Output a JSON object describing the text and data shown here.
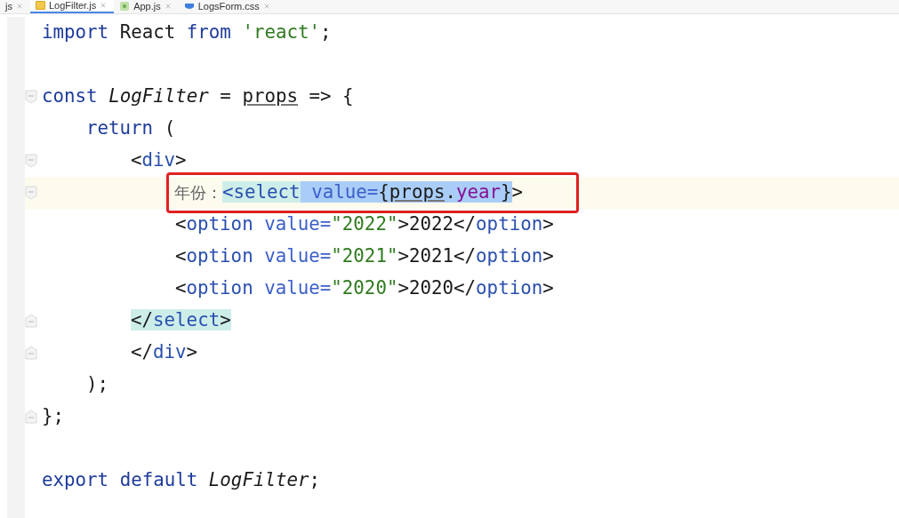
{
  "tabs": [
    {
      "label": "js",
      "kind": "plain",
      "selected": false
    },
    {
      "label": "LogFilter.js",
      "kind": "js",
      "selected": true
    },
    {
      "label": "App.js",
      "kind": "react",
      "selected": false
    },
    {
      "label": "LogsForm.css",
      "kind": "css",
      "selected": false
    }
  ],
  "lines": [
    {
      "kind": "code",
      "tokens": [
        {
          "text": "import",
          "kind": "keyword"
        },
        {
          "text": " React ",
          "kind": "plain"
        },
        {
          "text": "from",
          "kind": "keyword"
        },
        {
          "text": " 'react'",
          "kind": "string"
        },
        {
          "text": ";",
          "kind": "plain"
        }
      ]
    },
    {
      "kind": "blank"
    },
    {
      "kind": "fold-start",
      "tokens": [
        {
          "text": "const ",
          "kind": "keyword"
        },
        {
          "text": "LogFilter",
          "kind": "ident"
        },
        {
          "text": " = ",
          "kind": "plain"
        },
        {
          "text": "props",
          "kind": "param"
        },
        {
          "text": " => {",
          "kind": "plain"
        }
      ],
      "children": [
        {
          "kind": "code",
          "tokens": [
            {
              "text": "return",
              "kind": "keyword"
            },
            {
              "text": " (",
              "kind": "plain"
            }
          ],
          "children": [
            {
              "kind": "fold-start",
              "tokens": [
                {
                  "text": "<",
                  "kind": "plain"
                },
                {
                  "text": "div",
                  "kind": "tag"
                },
                {
                  "text": ">",
                  "kind": "plain"
                }
              ],
              "children": [
                {
                  "kind": "fold-start",
                  "current": true,
                  "boxed": true,
                  "tokens": [
                    {
                      "text": "年份：",
                      "kind": "cjk"
                    },
                    {
                      "text": "<select",
                      "kind": "tag",
                      "matched": true
                    },
                    {
                      "text": " value=",
                      "kind": "attr",
                      "selected": true
                    },
                    {
                      "text": "{",
                      "kind": "plain",
                      "selected": true
                    },
                    {
                      "text": "props",
                      "kind": "param",
                      "selected": true
                    },
                    {
                      "text": ".",
                      "kind": "plain",
                      "selected": true
                    },
                    {
                      "text": "year",
                      "kind": "field",
                      "selected": true
                    },
                    {
                      "text": "}",
                      "kind": "plain",
                      "selected": true
                    },
                    {
                      "text": ">",
                      "kind": "plain"
                    }
                  ]
                },
                {
                  "kind": "code",
                  "tokens": [
                    {
                      "text": "<",
                      "kind": "plain"
                    },
                    {
                      "text": "option",
                      "kind": "tag"
                    },
                    {
                      "text": " value=",
                      "kind": "attr"
                    },
                    {
                      "text": "\"2022\"",
                      "kind": "string"
                    },
                    {
                      "text": ">2022</",
                      "kind": "plain"
                    },
                    {
                      "text": "option",
                      "kind": "tag"
                    },
                    {
                      "text": ">",
                      "kind": "plain"
                    }
                  ]
                },
                {
                  "kind": "code",
                  "tokens": [
                    {
                      "text": "<",
                      "kind": "plain"
                    },
                    {
                      "text": "option",
                      "kind": "tag"
                    },
                    {
                      "text": " value=",
                      "kind": "attr"
                    },
                    {
                      "text": "\"2021\"",
                      "kind": "string"
                    },
                    {
                      "text": ">2021</",
                      "kind": "plain"
                    },
                    {
                      "text": "option",
                      "kind": "tag"
                    },
                    {
                      "text": ">",
                      "kind": "plain"
                    }
                  ]
                },
                {
                  "kind": "code",
                  "tokens": [
                    {
                      "text": "<",
                      "kind": "plain"
                    },
                    {
                      "text": "option",
                      "kind": "tag"
                    },
                    {
                      "text": " value=",
                      "kind": "attr"
                    },
                    {
                      "text": "\"2020\"",
                      "kind": "string"
                    },
                    {
                      "text": ">2020</",
                      "kind": "plain"
                    },
                    {
                      "text": "option",
                      "kind": "tag"
                    },
                    {
                      "text": ">",
                      "kind": "plain"
                    }
                  ]
                }
              ]
            },
            {
              "kind": "fold-end",
              "tokens": [
                {
                  "text": "</",
                  "kind": "plain",
                  "matched": true
                },
                {
                  "text": "select",
                  "kind": "tag",
                  "matched": true
                },
                {
                  "text": ">",
                  "kind": "plain",
                  "matched": true
                }
              ]
            },
            {
              "kind": "fold-end",
              "tokens": [
                {
                  "text": "</",
                  "kind": "plain"
                },
                {
                  "text": "div",
                  "kind": "tag"
                },
                {
                  "text": ">",
                  "kind": "plain"
                }
              ]
            }
          ]
        },
        {
          "kind": "code",
          "tokens": [
            {
              "text": ");",
              "kind": "plain"
            }
          ]
        }
      ]
    },
    {
      "kind": "fold-end",
      "tokens": [
        {
          "text": "};",
          "kind": "plain"
        }
      ]
    },
    {
      "kind": "blank"
    },
    {
      "kind": "code",
      "tokens": [
        {
          "text": "export ",
          "kind": "keyword"
        },
        {
          "text": "default ",
          "kind": "keyword"
        },
        {
          "text": "LogFilter",
          "kind": "ident"
        },
        {
          "text": ";",
          "kind": "plain"
        }
      ]
    }
  ]
}
